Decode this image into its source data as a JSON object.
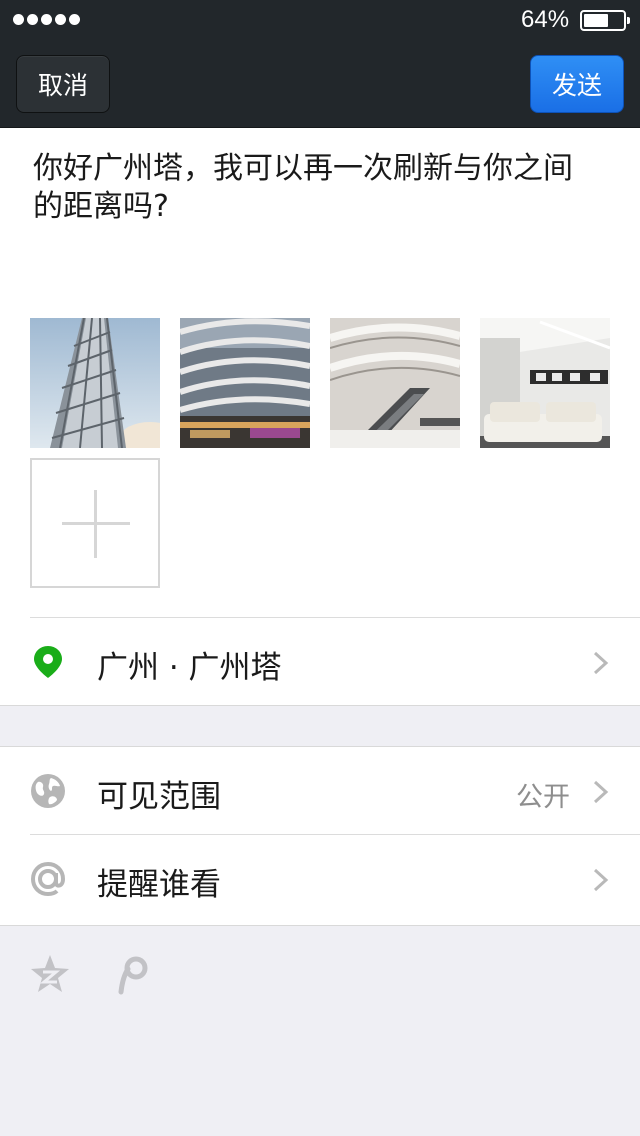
{
  "status_bar": {
    "battery_percent": "64%",
    "battery_level": 0.64
  },
  "nav": {
    "cancel_label": "取消",
    "send_label": "发送"
  },
  "post": {
    "text": "你好广州塔，我可以再一次刷新与你之间的距离吗?"
  },
  "photos": [
    {
      "icon": "canton-tower-photo"
    },
    {
      "icon": "curved-building-photo"
    },
    {
      "icon": "atrium-escalator-photo"
    },
    {
      "icon": "white-sofa-room-photo"
    }
  ],
  "location": {
    "label": "广州 · 广州塔",
    "icon": "location-pin-icon",
    "color": "#1aad19"
  },
  "visibility": {
    "label": "可见范围",
    "value": "公开",
    "icon": "globe-icon"
  },
  "mention": {
    "label": "提醒谁看",
    "icon": "at-icon"
  },
  "share_targets": [
    {
      "icon": "qzone-star-icon"
    },
    {
      "icon": "tencent-weibo-icon"
    }
  ],
  "colors": {
    "topbar": "#22272b",
    "send_button": "#1a7ae8",
    "background": "#efeff4"
  }
}
